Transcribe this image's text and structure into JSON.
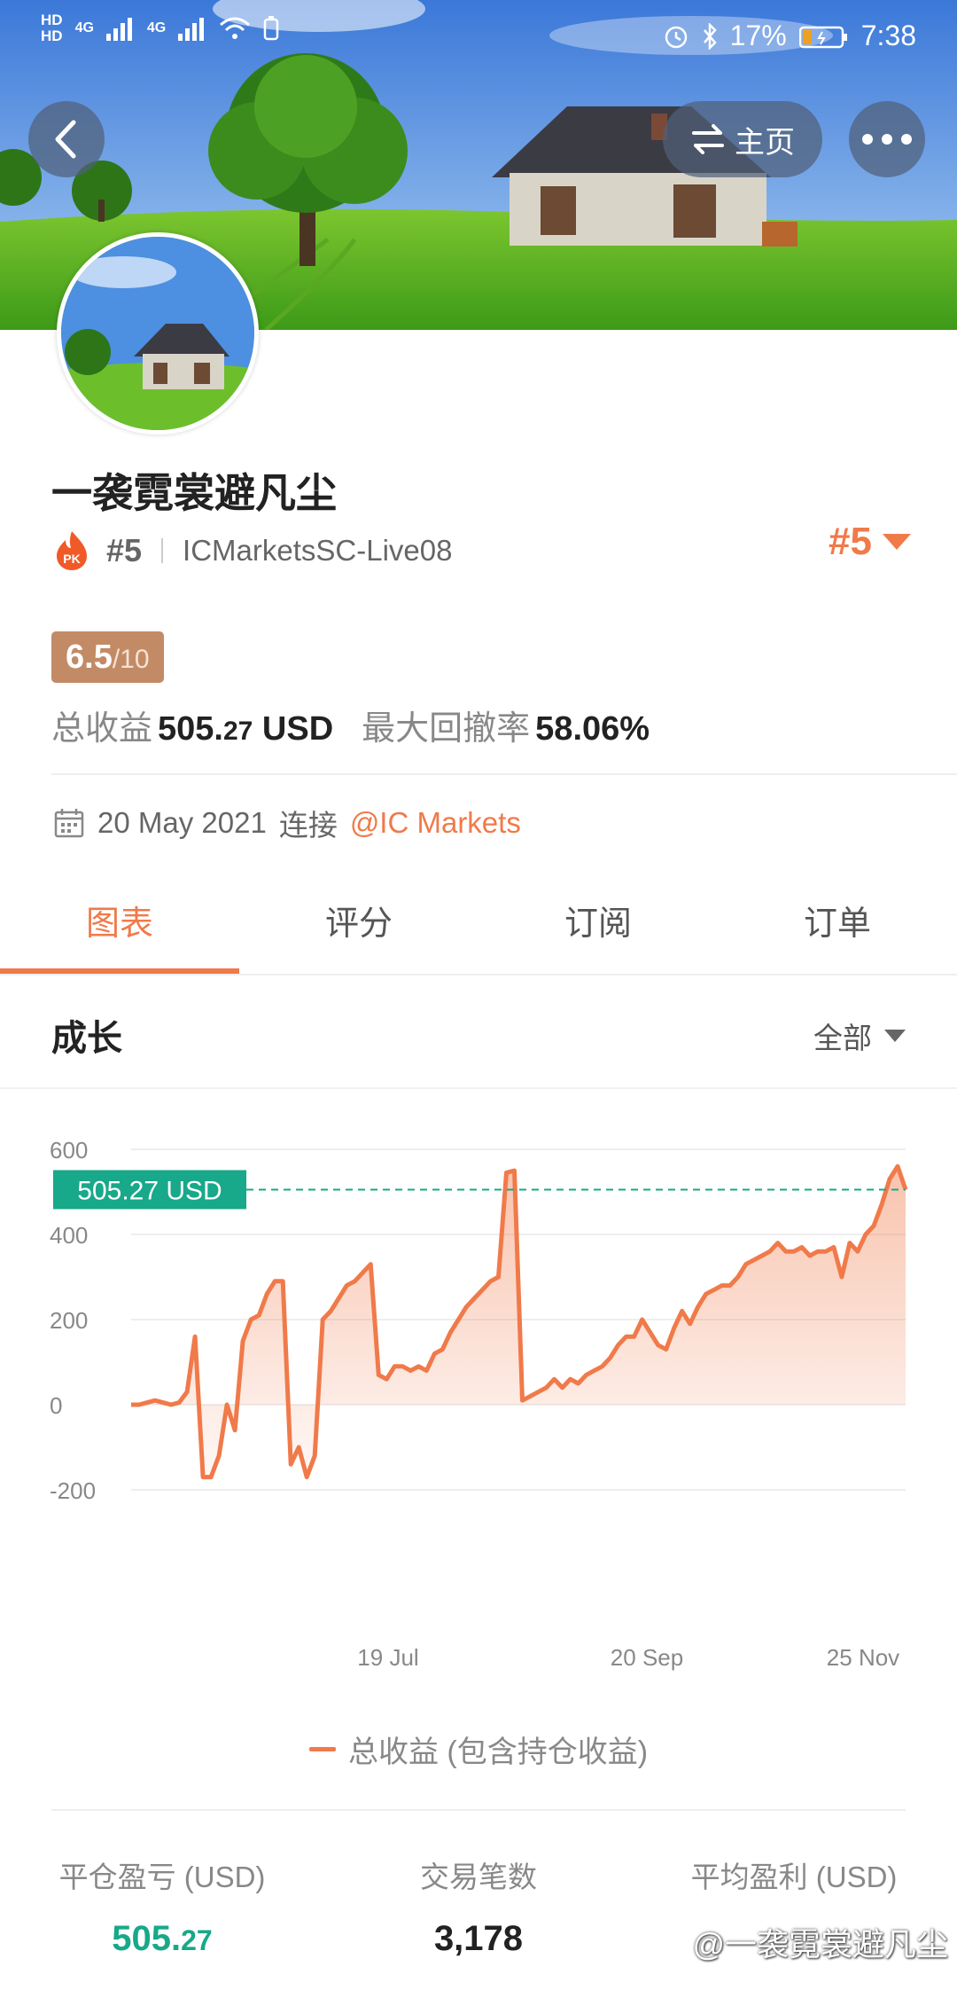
{
  "status_bar": {
    "hd1": "HD",
    "hd2": "HD",
    "net1": "4G",
    "net2": "4G",
    "battery_pct": "17%",
    "time": "7:38"
  },
  "header": {
    "home_label": "主页"
  },
  "profile": {
    "name": "一袭霓裳避凡尘",
    "pk_badge": "PK",
    "rank": "#5",
    "server": "ICMarketsSC-Live08",
    "rank_right": "#5",
    "score": "6.5",
    "score_max": "/10",
    "total_profit_label": "总收益",
    "total_profit_int": "505.",
    "total_profit_dec": "27",
    "total_profit_unit": " USD",
    "drawdown_label": "最大回撤率",
    "drawdown_value": "58.06%",
    "connect_date": "20 May 2021",
    "connect_text": "连接",
    "connect_broker": "@IC Markets"
  },
  "tabs": [
    {
      "label": "图表"
    },
    {
      "label": "评分"
    },
    {
      "label": "订阅"
    },
    {
      "label": "订单"
    }
  ],
  "section": {
    "title": "成长",
    "range": "全部"
  },
  "chart_data": {
    "type": "area",
    "y_ticks": [
      "600",
      "400",
      "200",
      "0",
      "-200"
    ],
    "x_ticks": [
      "19 Jul",
      "20 Sep",
      "25 Nov"
    ],
    "ylim": [
      -200,
      600
    ],
    "current_label": "505.27 USD",
    "current_value": 505.27,
    "series": [
      {
        "name": "总收益 (包含持仓收益)",
        "values": [
          0,
          0,
          5,
          10,
          5,
          0,
          5,
          30,
          160,
          -170,
          -170,
          -120,
          0,
          -60,
          150,
          200,
          210,
          260,
          290,
          290,
          -140,
          -100,
          -170,
          -120,
          200,
          220,
          250,
          280,
          290,
          310,
          330,
          70,
          60,
          90,
          90,
          80,
          90,
          80,
          120,
          130,
          170,
          200,
          230,
          250,
          270,
          290,
          300,
          545,
          550,
          10,
          20,
          30,
          40,
          60,
          40,
          60,
          50,
          70,
          80,
          90,
          110,
          140,
          160,
          160,
          200,
          170,
          140,
          130,
          180,
          220,
          190,
          230,
          260,
          270,
          280,
          280,
          300,
          330,
          340,
          350,
          360,
          380,
          360,
          360,
          370,
          350,
          360,
          360,
          370,
          300,
          380,
          360,
          400,
          420,
          470,
          530,
          560,
          505
        ]
      }
    ],
    "xlabel": "",
    "ylabel": ""
  },
  "legend_label": "总收益 (包含持仓收益)",
  "bottom_stats": [
    {
      "label": "平仓盈亏 (USD)",
      "value_int": "505.",
      "value_dec": "27"
    },
    {
      "label": "交易笔数",
      "value_int": "3,178",
      "value_dec": ""
    },
    {
      "label": "平均盈利 (USD)",
      "value_int": "",
      "value_dec": ""
    }
  ],
  "watermark": "@一袭霓裳避凡尘",
  "colors": {
    "accent": "#f07a4a",
    "teal": "#18a88a",
    "score_bg": "#c28b66"
  }
}
